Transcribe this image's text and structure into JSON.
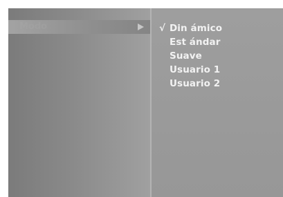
{
  "left_panel": {
    "selected_item_label": "Modo"
  },
  "right_panel": {
    "check_mark": "√",
    "options": [
      {
        "label": "Din ámico",
        "selected": true
      },
      {
        "label": "Est ándar",
        "selected": false
      },
      {
        "label": "Suave",
        "selected": false
      },
      {
        "label": "Usuario 1",
        "selected": false
      },
      {
        "label": "Usuario 2",
        "selected": false
      }
    ]
  },
  "colors": {
    "text": "#f2f2f2",
    "left_panel": "#8a8a8a",
    "right_panel": "#9a9a9a"
  }
}
